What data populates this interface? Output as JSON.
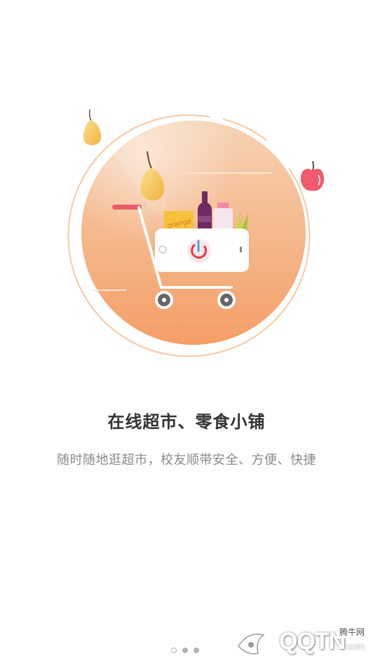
{
  "hero": {
    "cart_logo_icon": "refresh-power-icon",
    "box_label": "orange"
  },
  "headline": "在线超市、零食小铺",
  "subtitle": "随时随地逛超市，校友顺带安全、方便、快捷",
  "pager": {
    "total": 3,
    "active_index": 1
  },
  "watermark": {
    "text": "QQTN",
    "domain": ".com",
    "badge": "腾牛网"
  },
  "colors": {
    "circle_top": "#f3c59c",
    "circle_bottom": "#f5a46d",
    "ring": "#f7c9a5",
    "pear": "#f2c257",
    "apple": "#ef5a6c",
    "handle": "#e85c68",
    "text_primary": "#333333",
    "text_secondary": "#8a8a8a"
  }
}
